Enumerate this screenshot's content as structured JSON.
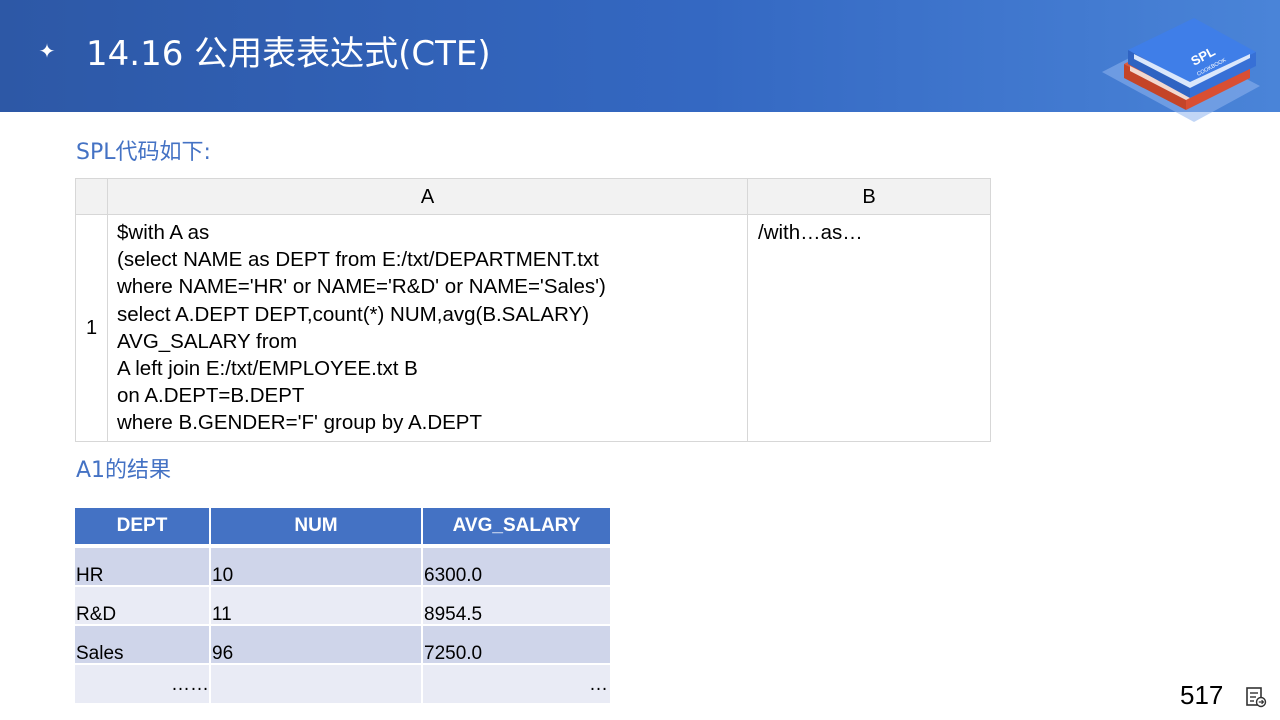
{
  "slide": {
    "title": "14.16 公用表表达式(CTE)",
    "page_number": "517"
  },
  "logo": {
    "text_main": "SPL",
    "text_sub": "COOKBOOK"
  },
  "code_section": {
    "label": "SPL代码如下:",
    "col_headers": [
      "A",
      "B"
    ],
    "row_number": "1",
    "cell_a_lines": [
      "$with A as",
      "(select NAME as DEPT from E:/txt/DEPARTMENT.txt",
      "where NAME='HR' or NAME='R&D' or NAME='Sales')",
      "select A.DEPT DEPT,count(*) NUM,avg(B.SALARY)",
      "AVG_SALARY from",
      "A left join  E:/txt/EMPLOYEE.txt  B",
      "on A.DEPT=B.DEPT",
      "where B.GENDER='F' group by A.DEPT"
    ],
    "cell_b": "/with…as…"
  },
  "result_section": {
    "label": "A1的结果",
    "headers": [
      "DEPT",
      "NUM",
      "AVG_SALARY"
    ],
    "rows": [
      [
        "HR",
        "10",
        "6300.0"
      ],
      [
        "R&D",
        "11",
        "8954.5"
      ],
      [
        "Sales",
        "96",
        "7250.0"
      ]
    ],
    "ellipsis": {
      "left": "……",
      "right": "…"
    }
  },
  "colors": {
    "header_blue": "#2d58a6",
    "accent_blue": "#4472c4",
    "row_dark": "#cfd5ea",
    "row_light": "#e9ebf5"
  },
  "icons": {
    "title_bullet": "sparkle-icon",
    "bottom_right": "notes-icon"
  }
}
